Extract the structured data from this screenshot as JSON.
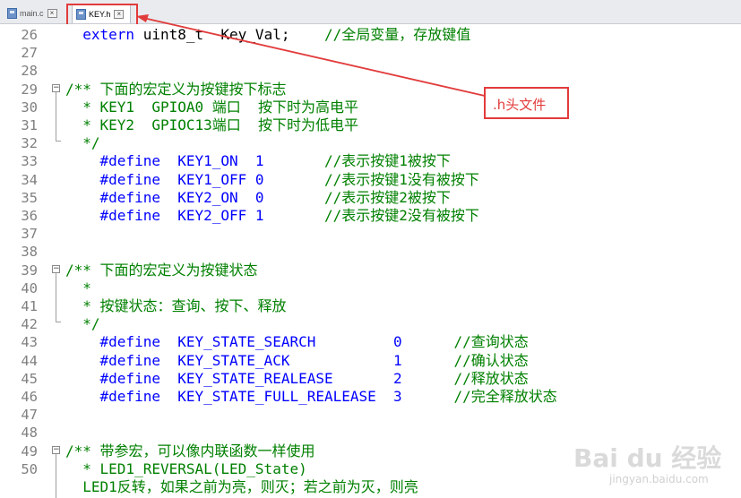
{
  "tabs": [
    {
      "label": "main.c"
    },
    {
      "label": "KEY.h"
    }
  ],
  "callout": ".h头文件",
  "watermark": {
    "brand": "Bai du 经验",
    "site": "jingyan.baidu.com"
  },
  "lines": [
    {
      "n": "26",
      "parts": [
        {
          "t": "  extern ",
          "c": "kw"
        },
        {
          "t": "uint8_t  Key_Val;    ",
          "c": "plain"
        },
        {
          "t": "//全局变量，存放键值",
          "c": "cm"
        }
      ]
    },
    {
      "n": "27",
      "parts": []
    },
    {
      "n": "28",
      "parts": []
    },
    {
      "n": "29",
      "parts": [
        {
          "t": "/** 下面的宏定义为按键按下标志",
          "c": "cm"
        }
      ]
    },
    {
      "n": "30",
      "parts": [
        {
          "t": "  * KEY1  GPIOA0 端口  按下时为高电平",
          "c": "cm"
        }
      ]
    },
    {
      "n": "31",
      "parts": [
        {
          "t": "  * KEY2  GPIOC13端口  按下时为低电平",
          "c": "cm"
        }
      ]
    },
    {
      "n": "32",
      "parts": [
        {
          "t": "  */",
          "c": "cm"
        }
      ]
    },
    {
      "n": "33",
      "parts": [
        {
          "t": "    #define  KEY1_ON  1       ",
          "c": "pp"
        },
        {
          "t": "//表示按键1被按下",
          "c": "cm"
        }
      ]
    },
    {
      "n": "34",
      "parts": [
        {
          "t": "    #define  KEY1_OFF 0       ",
          "c": "pp"
        },
        {
          "t": "//表示按键1没有被按下",
          "c": "cm"
        }
      ]
    },
    {
      "n": "35",
      "parts": [
        {
          "t": "    #define  KEY2_ON  0       ",
          "c": "pp"
        },
        {
          "t": "//表示按键2被按下",
          "c": "cm"
        }
      ]
    },
    {
      "n": "36",
      "parts": [
        {
          "t": "    #define  KEY2_OFF 1       ",
          "c": "pp"
        },
        {
          "t": "//表示按键2没有被按下",
          "c": "cm"
        }
      ]
    },
    {
      "n": "37",
      "parts": []
    },
    {
      "n": "38",
      "parts": []
    },
    {
      "n": "39",
      "parts": [
        {
          "t": "/** 下面的宏定义为按键状态",
          "c": "cm"
        }
      ]
    },
    {
      "n": "40",
      "parts": [
        {
          "t": "  *",
          "c": "cm"
        }
      ]
    },
    {
      "n": "41",
      "parts": [
        {
          "t": "  * 按键状态：查询、按下、释放",
          "c": "cm"
        }
      ]
    },
    {
      "n": "42",
      "parts": [
        {
          "t": "  */",
          "c": "cm"
        }
      ]
    },
    {
      "n": "43",
      "parts": [
        {
          "t": "    #define  KEY_STATE_SEARCH         0      ",
          "c": "pp"
        },
        {
          "t": "//查询状态",
          "c": "cm"
        }
      ]
    },
    {
      "n": "44",
      "parts": [
        {
          "t": "    #define  KEY_STATE_ACK            1      ",
          "c": "pp"
        },
        {
          "t": "//确认状态",
          "c": "cm"
        }
      ]
    },
    {
      "n": "45",
      "parts": [
        {
          "t": "    #define  KEY_STATE_REALEASE       2      ",
          "c": "pp"
        },
        {
          "t": "//释放状态",
          "c": "cm"
        }
      ]
    },
    {
      "n": "46",
      "parts": [
        {
          "t": "    #define  KEY_STATE_FULL_REALEASE  3      ",
          "c": "pp"
        },
        {
          "t": "//完全释放状态",
          "c": "cm"
        }
      ]
    },
    {
      "n": "47",
      "parts": []
    },
    {
      "n": "48",
      "parts": []
    },
    {
      "n": "49",
      "parts": [
        {
          "t": "/** 带参宏，可以像内联函数一样使用",
          "c": "cm"
        }
      ]
    },
    {
      "n": "50",
      "parts": [
        {
          "t": "  * LED1_REVERSAL(LED_State)",
          "c": "cm"
        }
      ]
    },
    {
      "n": "",
      "parts": [
        {
          "t": "  LED1反转，如果之前为亮，则灭；若之前为灭，则亮",
          "c": "cm"
        }
      ]
    }
  ]
}
